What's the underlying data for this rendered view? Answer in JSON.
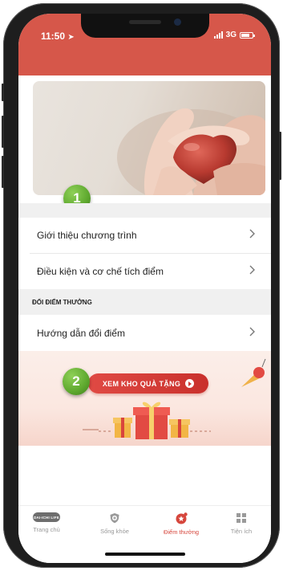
{
  "status_bar": {
    "time": "11:50",
    "network": "3G",
    "location_icon": "location-arrow-icon"
  },
  "badges": {
    "first": "1",
    "second": "2"
  },
  "menu": {
    "items": [
      {
        "label": "Giới thiệu chương trình"
      },
      {
        "label": "Điều kiện và cơ chế tích điểm"
      }
    ],
    "section_title": "ĐỔI ĐIỂM THƯỞNG",
    "section_items": [
      {
        "label": "Hướng dẫn đổi điểm"
      }
    ]
  },
  "promo": {
    "button_label": "XEM KHO QUÀ TẶNG"
  },
  "tab_bar": {
    "tabs": [
      {
        "label": "Trang chủ",
        "icon": "dai-ichi-life-logo",
        "logo_text": "DAI-ICHI LIFE"
      },
      {
        "label": "Sống khỏe",
        "icon": "shield-plus-icon"
      },
      {
        "label": "Điểm thưởng",
        "icon": "star-badge-icon",
        "active": true
      },
      {
        "label": "Tiện ích",
        "icon": "grid-icon"
      }
    ]
  },
  "colors": {
    "brand": "#d6574a",
    "badge": "#5ea82e",
    "active_tab": "#d6463c"
  }
}
